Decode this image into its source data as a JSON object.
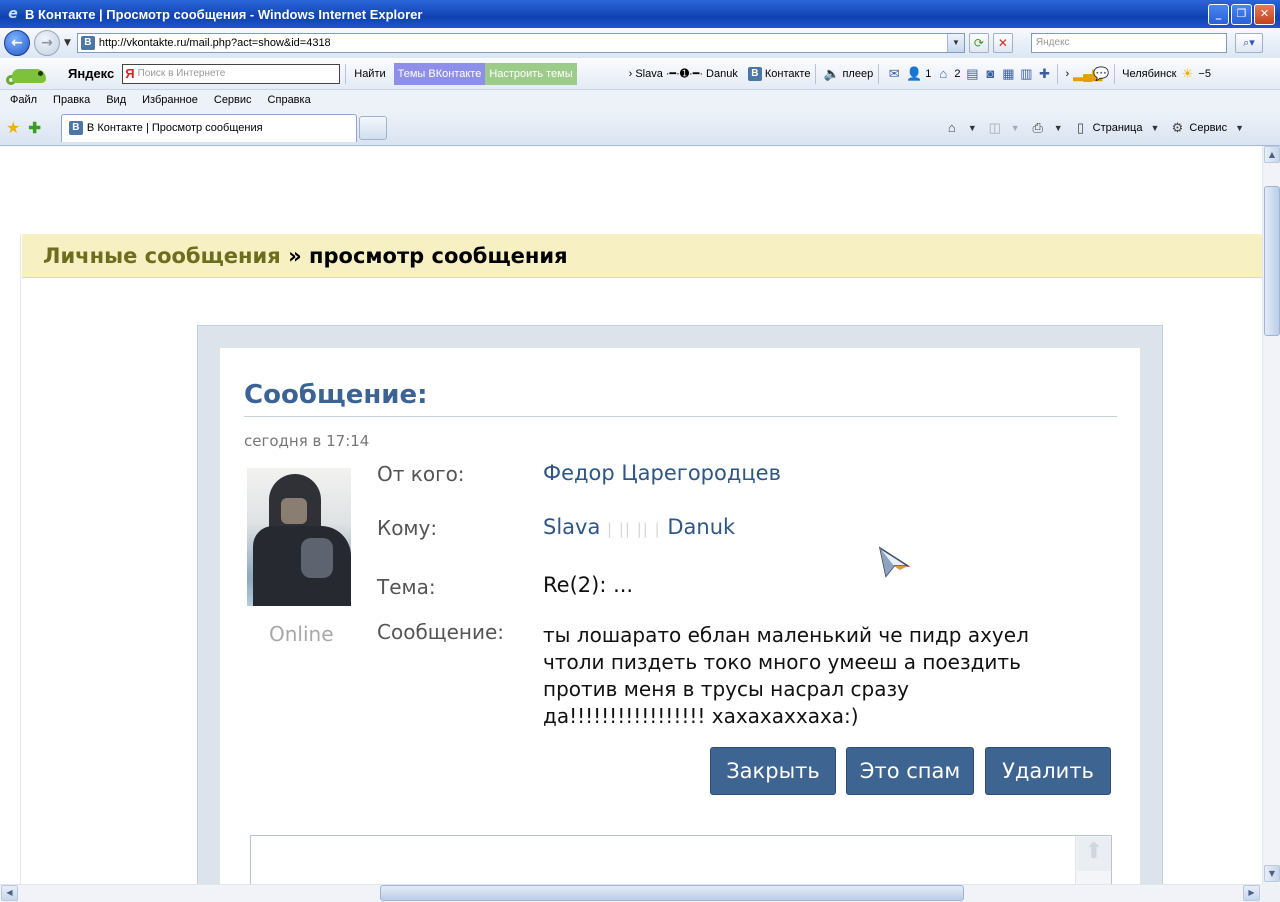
{
  "window": {
    "title": "В Контакте  | Просмотр сообщения - Windows Internet Explorer",
    "minimize_glyph": "_",
    "maximize_glyph": "❐",
    "close_glyph": "✕"
  },
  "address_bar": {
    "url": "http://vkontakte.ru/mail.php?act=show&id=4318",
    "search_placeholder": "Яндекс",
    "favicon_letter": "B"
  },
  "yandex_bar": {
    "logo": "Яндекс",
    "logo_mark": "Я",
    "search_placeholder": "Поиск в Интернете",
    "find_label": "Найти",
    "themes_label": "Темы ВКонтакте",
    "config_label": "Настроить темы",
    "user_label": "Slava ·━·➊·━· Danuk",
    "vk_label": "Контакте",
    "vk_letter": "B",
    "player_label": "плеер",
    "friends_count": "1",
    "home_count": "2",
    "city": "Челябинск",
    "temperature": "−5"
  },
  "menu": [
    "Файл",
    "Правка",
    "Вид",
    "Избранное",
    "Сервис",
    "Справка"
  ],
  "tab": {
    "label": "В Контакте | Просмотр сообщения",
    "favicon_letter": "B"
  },
  "command_bar": {
    "page_label": "Страница",
    "tools_label": "Сервис"
  },
  "page": {
    "breadcrumb_link": "Личные сообщения",
    "breadcrumb_sep": " » ",
    "breadcrumb_current": "просмотр сообщения",
    "message_title": "Сообщение:",
    "message_date": "сегодня в 17:14",
    "online_status": "Online",
    "labels": {
      "from": "От кого:",
      "to": "Кому:",
      "subject": "Тема:",
      "message": "Сообщение:"
    },
    "from_name": "Федор Царегородцев",
    "to_first": "Slava",
    "to_middle": "| || || |",
    "to_last": "Danuk",
    "subject": "Re(2): ...",
    "message_body": "ты лошарато еблан маленький че пидр ахуел чтоли пиздеть токо много умееш а поездить против меня в трусы насрал сразу да!!!!!!!!!!!!!!!!! хахахаххаха:)",
    "buttons": {
      "close": "Закрыть",
      "spam": "Это спам",
      "delete": "Удалить"
    }
  },
  "colors": {
    "title_bar": "#1a4ec0",
    "link": "#2e5686",
    "header_bg": "#f7f0c2",
    "button_bg": "#3e6592",
    "message_title": "#3b6394"
  },
  "icons": {
    "back": "arrow-left-icon",
    "forward": "arrow-right-icon",
    "refresh": "refresh-icon",
    "stop": "stop-icon",
    "search": "magnifier-icon",
    "favorites": "star-icon",
    "add_favorite": "add-favorite-icon",
    "home": "home-icon",
    "feeds": "rss-icon",
    "print": "printer-icon",
    "page": "page-icon",
    "tools": "gear-icon"
  }
}
